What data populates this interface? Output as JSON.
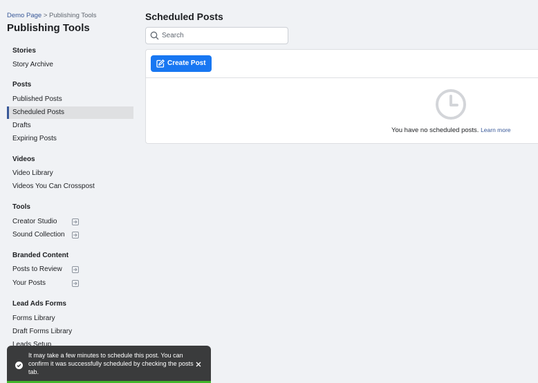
{
  "breadcrumb": {
    "parent": "Demo Page",
    "separator": ">",
    "current": "Publishing Tools"
  },
  "sidebar": {
    "title": "Publishing Tools",
    "sections": [
      {
        "heading": "Stories",
        "items": [
          {
            "label": "Story Archive"
          }
        ]
      },
      {
        "heading": "Posts",
        "items": [
          {
            "label": "Published Posts"
          },
          {
            "label": "Scheduled Posts",
            "active": true
          },
          {
            "label": "Drafts"
          },
          {
            "label": "Expiring Posts"
          }
        ]
      },
      {
        "heading": "Videos",
        "items": [
          {
            "label": "Video Library"
          },
          {
            "label": "Videos You Can Crosspost"
          }
        ]
      },
      {
        "heading": "Tools",
        "items": [
          {
            "label": "Creator Studio",
            "icon": "external-link-icon"
          },
          {
            "label": "Sound Collection",
            "icon": "external-link-icon"
          }
        ]
      },
      {
        "heading": "Branded Content",
        "items": [
          {
            "label": "Posts to Review",
            "icon": "external-link-icon"
          },
          {
            "label": "Your Posts",
            "icon": "external-link-icon"
          }
        ]
      },
      {
        "heading": "Lead Ads Forms",
        "items": [
          {
            "label": "Forms Library"
          },
          {
            "label": "Draft Forms Library"
          },
          {
            "label": "Leads Setup"
          }
        ]
      }
    ]
  },
  "main": {
    "title": "Scheduled Posts",
    "search": {
      "placeholder": "Search",
      "value": "",
      "icon": "search-icon"
    },
    "create_button": {
      "label": "Create Post",
      "icon": "edit-icon"
    },
    "empty_state": {
      "icon": "clock-icon",
      "message": "You have no scheduled posts.",
      "link": "Learn more"
    }
  },
  "toast": {
    "icon": "check-circle-icon",
    "message": "It may take a few minutes to schedule this post. You can confirm it was successfully scheduled by checking the posts tab.",
    "close_icon": "close-icon"
  },
  "colors": {
    "background": "#f0f2f5",
    "primary": "#1877f2",
    "link": "#385898",
    "toast_background": "#3a3b3c",
    "toast_progress": "#42b72a"
  }
}
